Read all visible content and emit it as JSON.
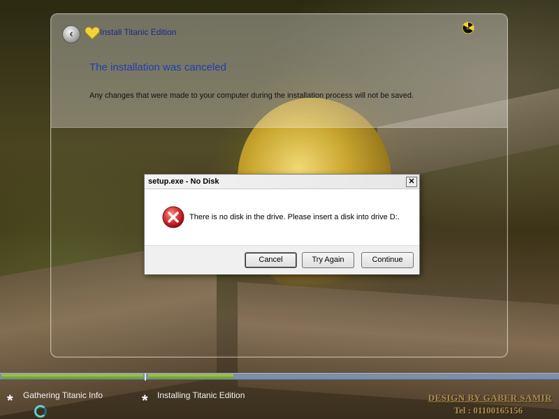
{
  "installer": {
    "title": "Install Titanic Edition",
    "heading": "The installation was canceled",
    "description": "Any changes that were made to your computer during the installation process will not be saved."
  },
  "dialog": {
    "title": "setup.exe - No Disk",
    "close_symbol": "✕",
    "message": "There is no disk in the drive. Please insert a disk into drive D:.",
    "buttons": {
      "cancel": "Cancel",
      "try_again": "Try Again",
      "continue": "Continue"
    }
  },
  "steps": [
    {
      "label": "Gathering Titanic Info",
      "marker": "*"
    },
    {
      "label": "Installing Titanic Edition",
      "marker": "*"
    }
  ],
  "credit": {
    "design": "DESIGN BY GABER SAMIR",
    "tel": "Tel : 01100165156"
  },
  "icons": {
    "back": "back-arrow-icon",
    "heart": "heart-icon",
    "radiation": "radiation-icon",
    "error": "error-x-icon",
    "spinner": "loading-spinner-icon"
  },
  "colors": {
    "heading_blue": "#1d3fb0",
    "title_blue": "#1a2a8a",
    "progress_green": "#8cbf2e",
    "progress_track": "#7c8ea8",
    "error_red": "#d32f2f",
    "credit_gold": "#a88c52"
  }
}
